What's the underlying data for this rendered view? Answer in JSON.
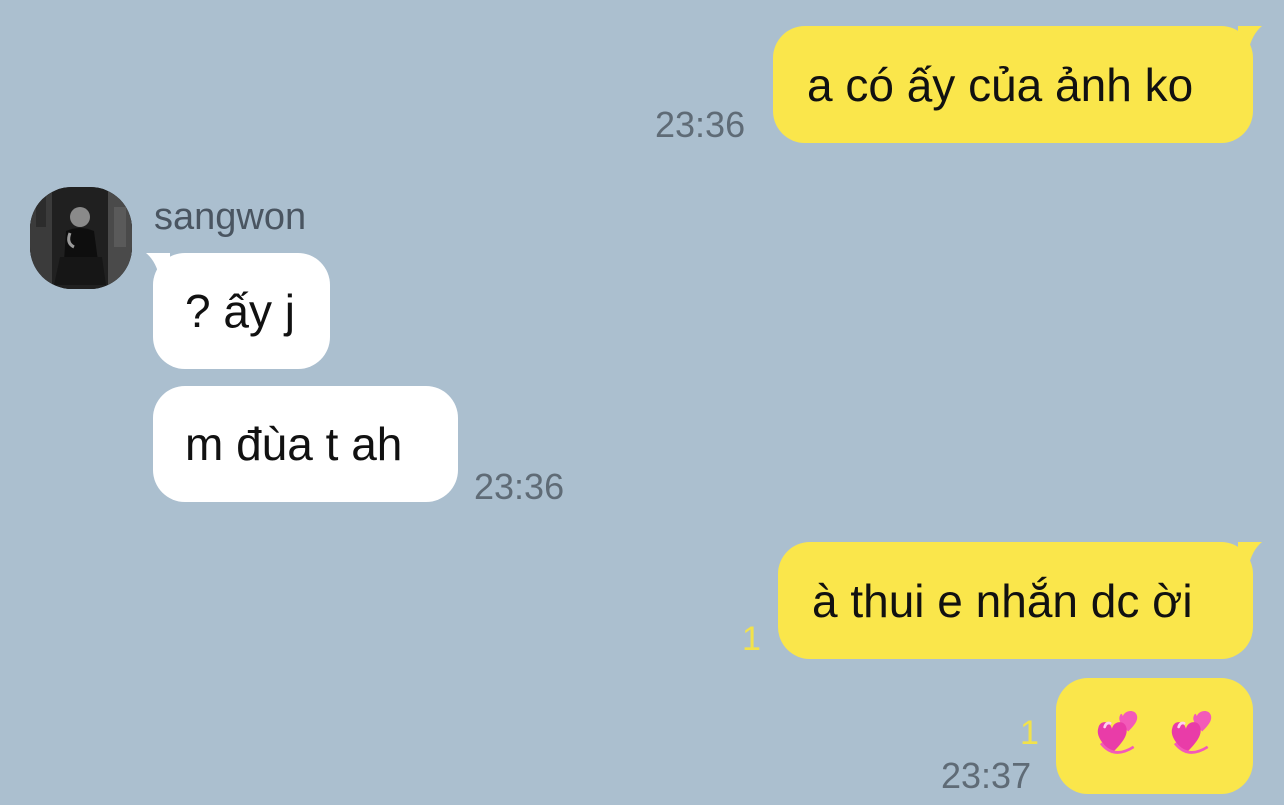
{
  "conversation": {
    "contact_name": "sangwon",
    "messages": [
      {
        "id": "m1",
        "sender": "me",
        "text": "a có ấy của ảnh ko",
        "time": "23:36",
        "unread": ""
      },
      {
        "id": "m2",
        "sender": "sangwon",
        "text": "? ấy j",
        "time": "",
        "unread": ""
      },
      {
        "id": "m3",
        "sender": "sangwon",
        "text": "m đùa t ah",
        "time": "23:36",
        "unread": ""
      },
      {
        "id": "m4",
        "sender": "me",
        "text": "à thui e nhắn dc ời",
        "time": "",
        "unread": "1"
      },
      {
        "id": "m5",
        "sender": "me",
        "text": "",
        "emojis": [
          "two-hearts-emoji",
          "two-hearts-emoji"
        ],
        "time": "23:37",
        "unread": "1"
      }
    ]
  },
  "colors": {
    "background": "#abbfcf",
    "outgoing_bubble": "#fae64b",
    "incoming_bubble": "#ffffff",
    "timestamp": "#5f6b76",
    "unread_count": "#f2e24a"
  }
}
